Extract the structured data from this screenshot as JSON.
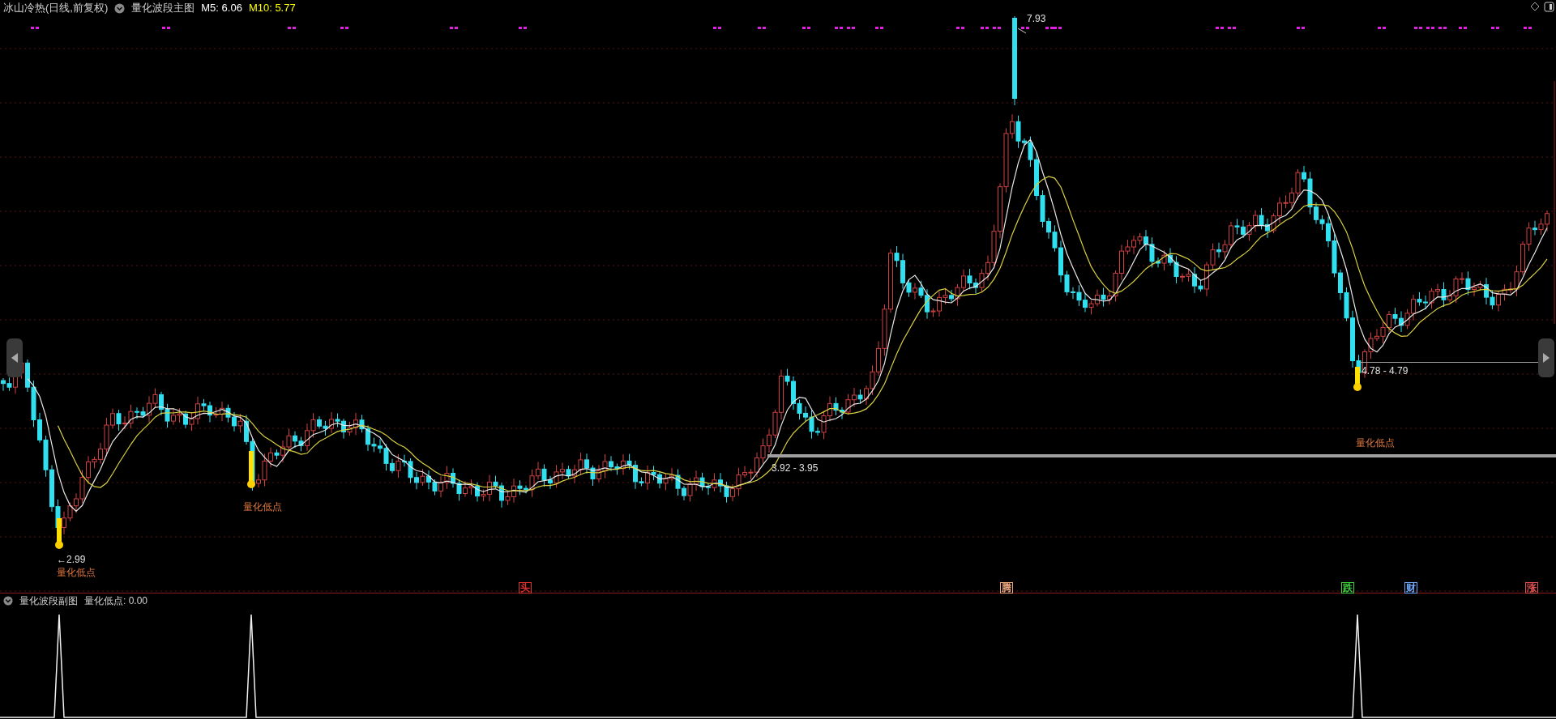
{
  "header": {
    "title": "冰山冷热(日线,前复权)",
    "indicator": "量化波段主图",
    "ma": [
      {
        "label": "M5: 6.06",
        "color": "#ffffff"
      },
      {
        "label": "M10: 5.77",
        "color": "#ffff00"
      }
    ]
  },
  "main_chart": {
    "low_labels": [
      "量化低点",
      "量化低点",
      "量化低点"
    ],
    "price_labels": [
      "←2.99",
      "7.93",
      "3.92 - 3.95",
      "4.78 - 4.79"
    ],
    "markers": [
      {
        "label": "头",
        "color": "#e03030"
      },
      {
        "label": "腾",
        "color": "#f0a880"
      },
      {
        "label": "跌",
        "color": "#40d040"
      },
      {
        "label": "财",
        "color": "#70a8ff"
      },
      {
        "label": "涨",
        "color": "#e05050"
      }
    ]
  },
  "sub_chart": {
    "title": "量化波段副图",
    "reading": "量化低点: 0.00"
  }
}
